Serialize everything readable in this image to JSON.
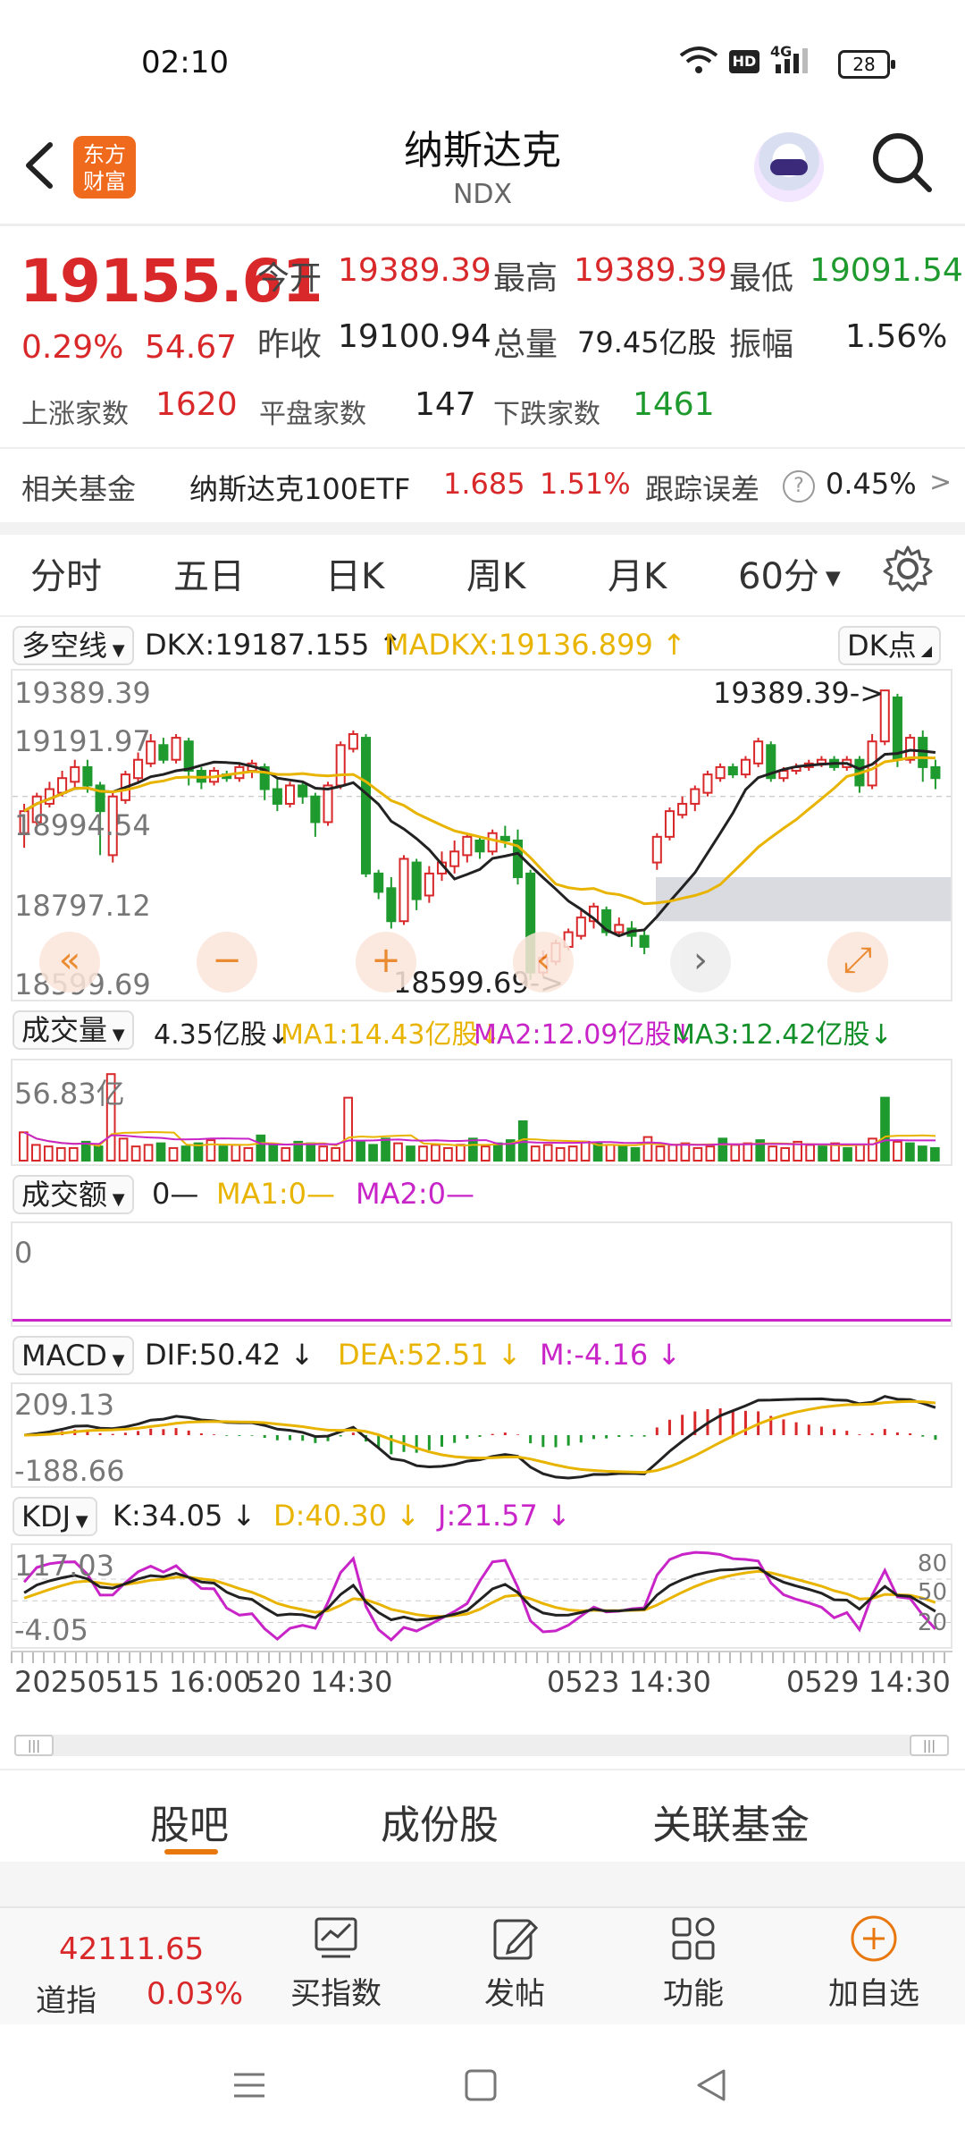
{
  "status": {
    "time": "02:10",
    "battery": "28",
    "signal": "4G",
    "hd": "HD"
  },
  "header": {
    "title": "纳斯达克",
    "subtitle": "NDX",
    "logo_text": "东方财富"
  },
  "quote": {
    "price": "19155.61",
    "change_pct": "0.29%",
    "change": "54.67",
    "open_label": "今开",
    "open": "19389.39",
    "high_label": "最高",
    "high": "19389.39",
    "low_label": "最低",
    "low": "19091.54",
    "prev_label": "昨收",
    "prev": "19100.94",
    "vol_label": "总量",
    "vol": "79.45亿股",
    "amp_label": "振幅",
    "amp": "1.56%",
    "up_label": "上涨家数",
    "up": "1620",
    "flat_label": "平盘家数",
    "flat": "147",
    "down_label": "下跌家数",
    "down": "1461"
  },
  "fund": {
    "label": "相关基金",
    "name": "纳斯达克100ETF",
    "price": "1.685",
    "pct": "1.51%",
    "track_label": "跟踪误差",
    "track": "0.45%",
    "arrow": ">"
  },
  "period_tabs": [
    "分时",
    "五日",
    "日K",
    "周K",
    "月K",
    "60分"
  ],
  "period_active_index": 5,
  "main_chart": {
    "indicator": "多空线",
    "dkx": "DKX:19187.155",
    "madkx": "MADKX:19136.899",
    "dk_button": "DK点",
    "y_labels": [
      "19389.39",
      "19191.97",
      "18994.54",
      "18797.12",
      "18599.69"
    ],
    "max_label": "19389.39->",
    "min_label": "18599.69->",
    "ymax": 19389.39,
    "ymin": 18599.69,
    "candles": [
      [
        19000,
        19060,
        18960,
        19080
      ],
      [
        19030,
        19100,
        19020,
        19110
      ],
      [
        19080,
        19120,
        19070,
        19140
      ],
      [
        19110,
        19150,
        19100,
        19170
      ],
      [
        19140,
        19180,
        19120,
        19200
      ],
      [
        19180,
        19130,
        19110,
        19200
      ],
      [
        19130,
        19060,
        18940,
        19140
      ],
      [
        18940,
        19100,
        18920,
        19110
      ],
      [
        19090,
        19160,
        19080,
        19170
      ],
      [
        19150,
        19200,
        19140,
        19220
      ],
      [
        19190,
        19250,
        19180,
        19270
      ],
      [
        19240,
        19200,
        19190,
        19260
      ],
      [
        19200,
        19260,
        19190,
        19270
      ],
      [
        19250,
        19170,
        19130,
        19260
      ],
      [
        19170,
        19140,
        19120,
        19180
      ],
      [
        19140,
        19170,
        19130,
        19180
      ],
      [
        19160,
        19150,
        19140,
        19170
      ],
      [
        19150,
        19180,
        19140,
        19190
      ],
      [
        19170,
        19190,
        19150,
        19200
      ],
      [
        19180,
        19120,
        19090,
        19190
      ],
      [
        19120,
        19080,
        19060,
        19150
      ],
      [
        19080,
        19130,
        19070,
        19140
      ],
      [
        19130,
        19100,
        19080,
        19140
      ],
      [
        19100,
        19030,
        18990,
        19110
      ],
      [
        19030,
        19130,
        19020,
        19140
      ],
      [
        19130,
        19240,
        19120,
        19250
      ],
      [
        19230,
        19270,
        19220,
        19280
      ],
      [
        19260,
        18890,
        18880,
        19270
      ],
      [
        18890,
        18840,
        18820,
        18900
      ],
      [
        18850,
        18760,
        18740,
        18880
      ],
      [
        18760,
        18930,
        18750,
        18940
      ],
      [
        18920,
        18820,
        18790,
        18930
      ],
      [
        18830,
        18890,
        18810,
        18910
      ],
      [
        18890,
        18920,
        18870,
        18950
      ],
      [
        18910,
        18950,
        18890,
        18980
      ],
      [
        18940,
        18990,
        18920,
        19000
      ],
      [
        18980,
        18950,
        18930,
        18990
      ],
      [
        18950,
        19000,
        18940,
        19010
      ],
      [
        18990,
        18980,
        18960,
        19020
      ],
      [
        18980,
        18880,
        18860,
        19010
      ],
      [
        18890,
        18620,
        18600,
        18900
      ],
      [
        18620,
        18660,
        18610,
        18680
      ],
      [
        18650,
        18700,
        18640,
        18710
      ],
      [
        18690,
        18730,
        18680,
        18740
      ],
      [
        18720,
        18770,
        18710,
        18790
      ],
      [
        18760,
        18800,
        18740,
        18810
      ],
      [
        18790,
        18730,
        18720,
        18800
      ],
      [
        18730,
        18750,
        18720,
        18770
      ],
      [
        18740,
        18720,
        18690,
        18760
      ],
      [
        18720,
        18690,
        18670,
        18740
      ],
      [
        18920,
        18990,
        18900,
        19000
      ],
      [
        18990,
        19060,
        18980,
        19070
      ],
      [
        19050,
        19080,
        19040,
        19100
      ],
      [
        19080,
        19120,
        19060,
        19130
      ],
      [
        19110,
        19160,
        19100,
        19170
      ],
      [
        19150,
        19180,
        19140,
        19190
      ],
      [
        19180,
        19160,
        19150,
        19190
      ],
      [
        19160,
        19200,
        19150,
        19210
      ],
      [
        19190,
        19250,
        19180,
        19260
      ],
      [
        19240,
        19150,
        19140,
        19250
      ],
      [
        19150,
        19170,
        19140,
        19180
      ],
      [
        19170,
        19180,
        19160,
        19190
      ],
      [
        19180,
        19190,
        19170,
        19200
      ],
      [
        19190,
        19200,
        19180,
        19210
      ],
      [
        19200,
        19180,
        19170,
        19210
      ],
      [
        19180,
        19200,
        19170,
        19210
      ],
      [
        19200,
        19130,
        19110,
        19210
      ],
      [
        19130,
        19250,
        19120,
        19270
      ],
      [
        19250,
        19389,
        19240,
        19389
      ],
      [
        19370,
        19200,
        19180,
        19380
      ],
      [
        19200,
        19260,
        19190,
        19270
      ],
      [
        19260,
        19180,
        19140,
        19280
      ],
      [
        19180,
        19150,
        19120,
        19200
      ]
    ],
    "controls": [
      "«",
      "−",
      "+",
      "‹",
      "›",
      "⤢"
    ]
  },
  "volume": {
    "indicator": "成交量",
    "value": "4.35亿股",
    "ma1": "MA1:14.43亿股",
    "ma2": "MA2:12.09亿股",
    "ma3": "MA3:12.42亿股",
    "y_label": "56.83亿",
    "bars": [
      18,
      10,
      9,
      8,
      8,
      12,
      9,
      55,
      14,
      9,
      10,
      11,
      8,
      9,
      11,
      13,
      9,
      10,
      8,
      16,
      10,
      8,
      12,
      11,
      9,
      8,
      40,
      12,
      10,
      14,
      11,
      9,
      9,
      10,
      8,
      10,
      14,
      9,
      11,
      13,
      25,
      9,
      10,
      8,
      9,
      12,
      11,
      10,
      9,
      8,
      15,
      9,
      10,
      11,
      8,
      9,
      14,
      10,
      11,
      13,
      9,
      8,
      12,
      10,
      9,
      11,
      8,
      10,
      14,
      40,
      12,
      11,
      9,
      8
    ]
  },
  "amount": {
    "indicator": "成交额",
    "value": "0—",
    "ma1": "MA1:0—",
    "ma2": "MA2:0—",
    "y_label": "0"
  },
  "macd": {
    "indicator": "MACD",
    "dif": "DIF:50.42",
    "dea": "DEA:52.51",
    "m": "M:-4.16",
    "y_top": "209.13",
    "y_bottom": "-188.66"
  },
  "kdj": {
    "indicator": "KDJ",
    "k": "K:34.05",
    "d": "D:40.30",
    "j": "J:21.57",
    "y_top": "117.03",
    "y_bottom": "-4.05",
    "levels": [
      "80",
      "50",
      "20"
    ]
  },
  "time_axis": [
    "20250515 16:00",
    "520 14:30",
    "0523 14:30",
    "0529 14:30"
  ],
  "bottom_tabs": [
    "股吧",
    "成份股",
    "关联基金"
  ],
  "bottom_nav": {
    "dji_value": "42111.65",
    "dji_label": "道指",
    "dji_pct": "0.03%",
    "items": [
      "买指数",
      "发帖",
      "功能",
      "加自选"
    ]
  },
  "colors": {
    "up": "#d8282a",
    "down": "#1f9a2e",
    "accent": "#e8770e"
  }
}
